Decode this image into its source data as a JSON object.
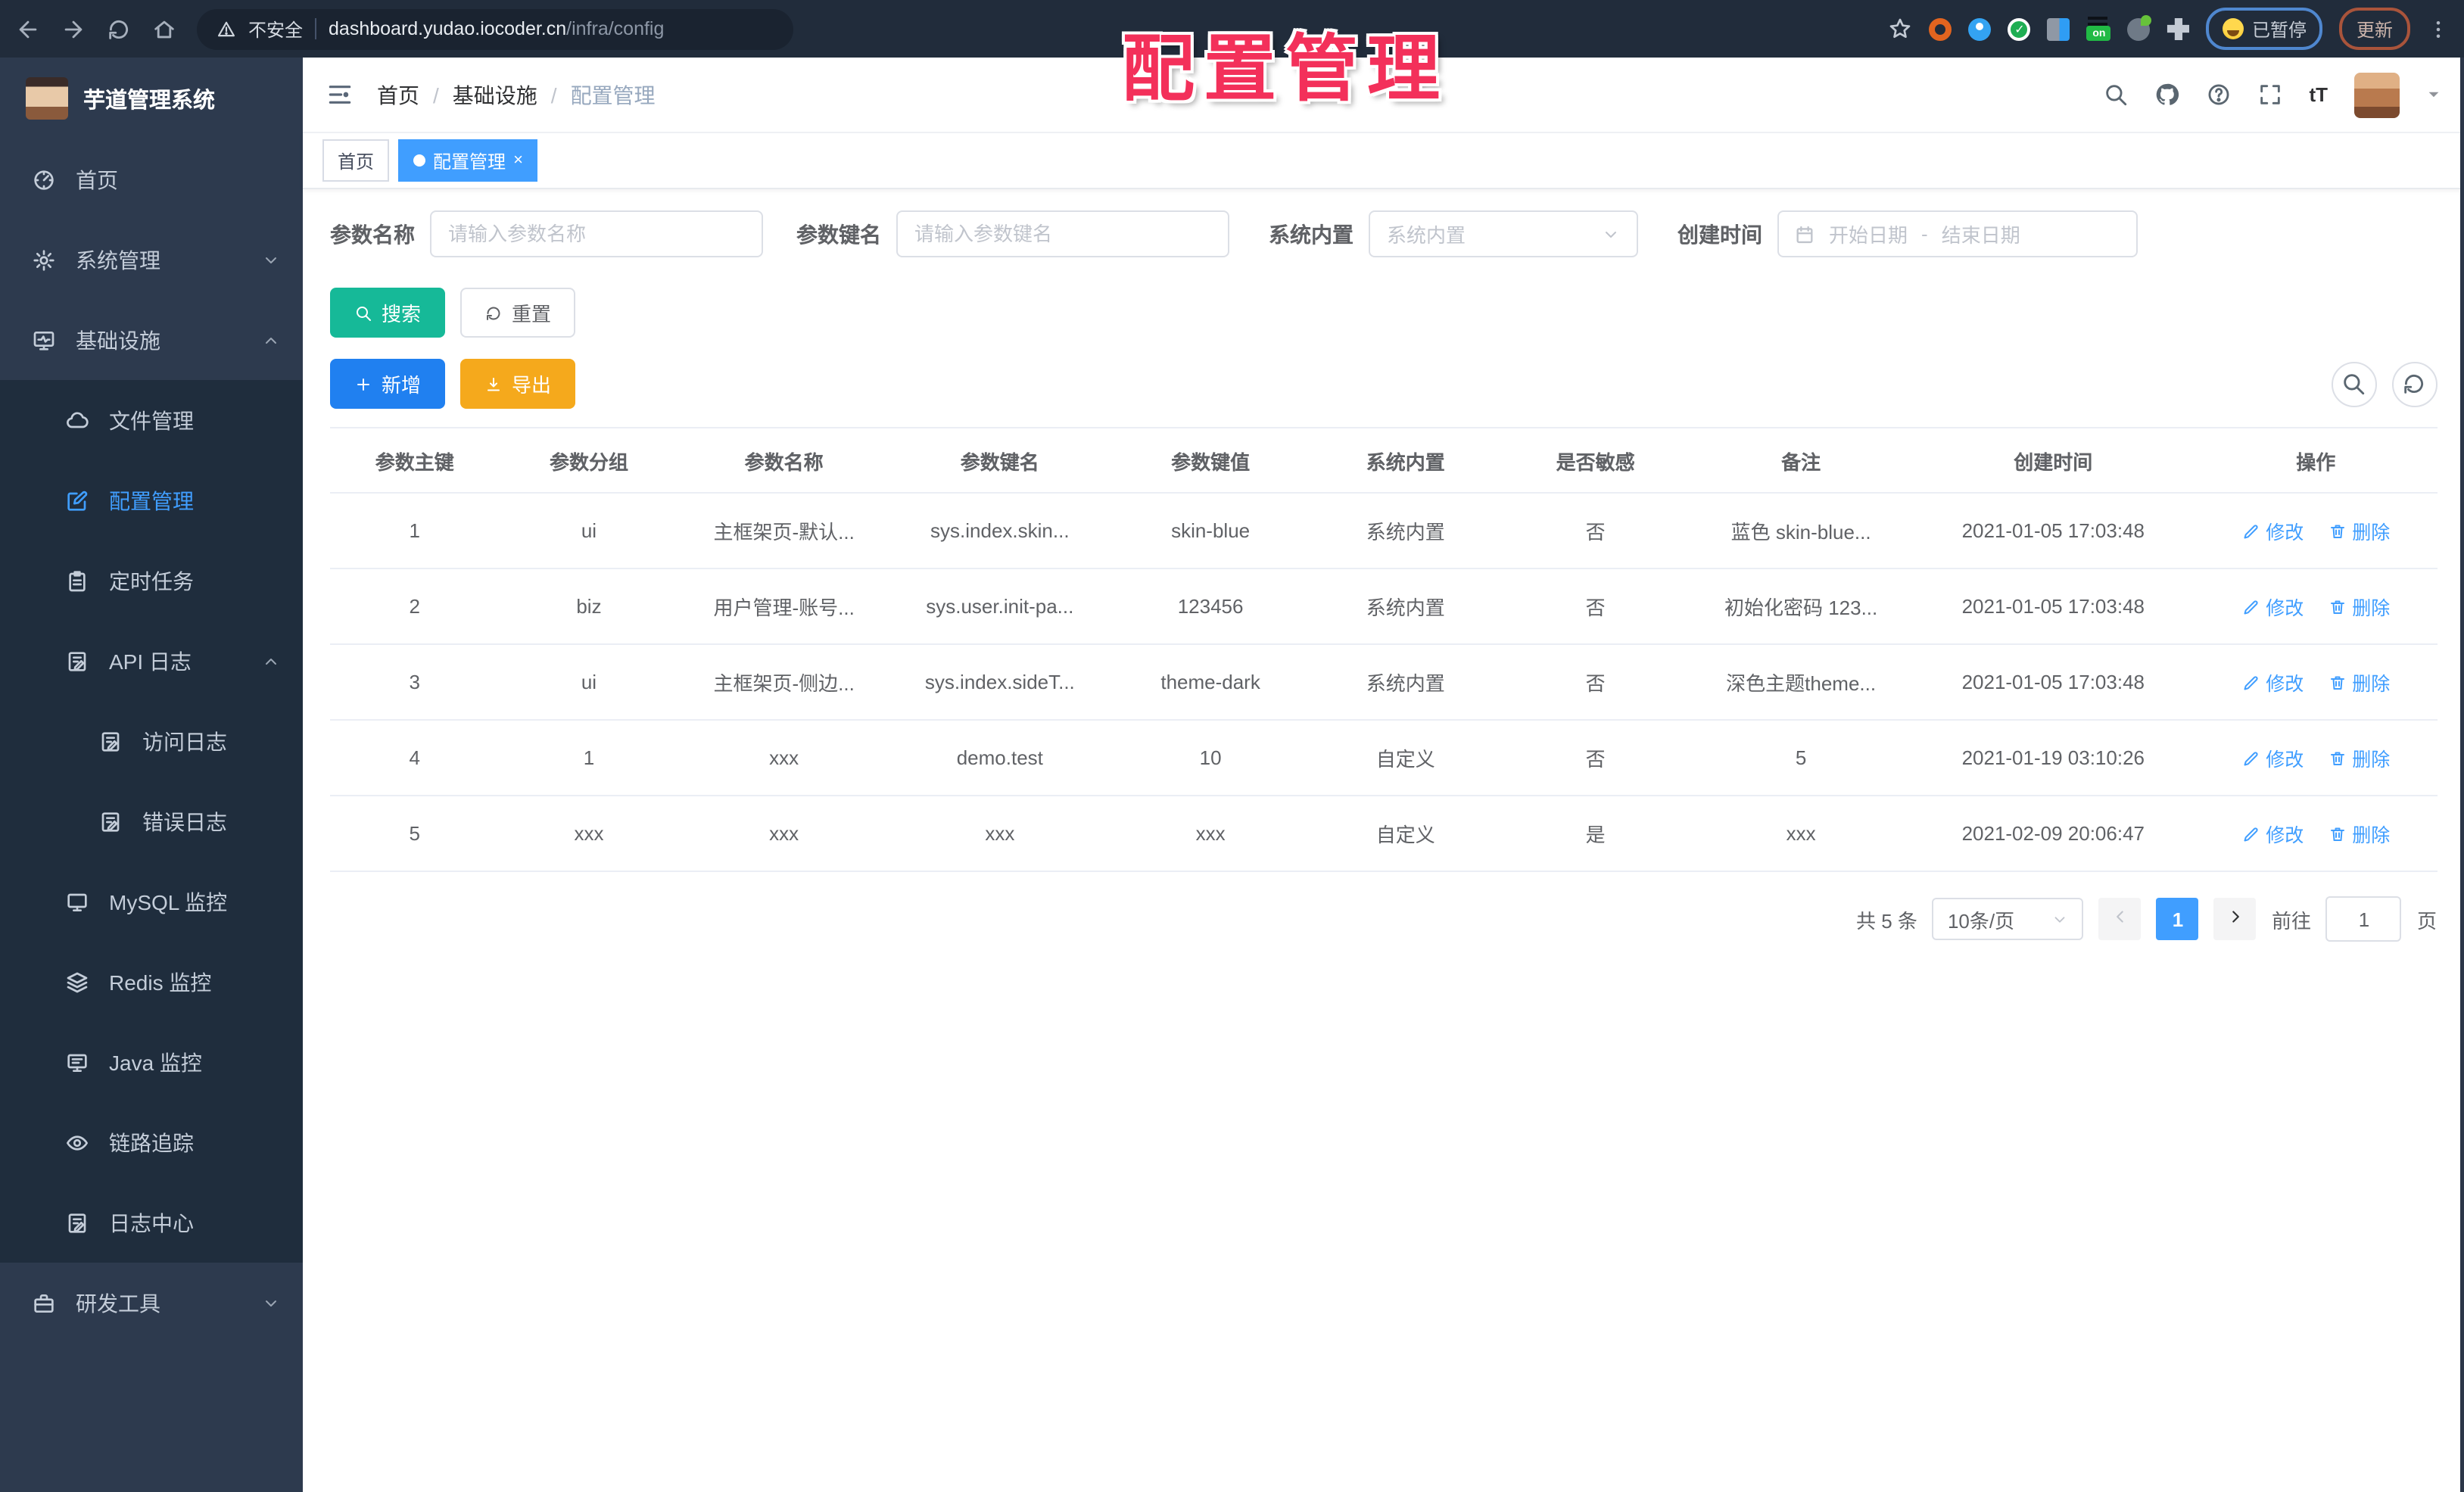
{
  "browser": {
    "security_label": "不安全",
    "host": "dashboard.yudao.iocoder.cn",
    "path": "/infra/config",
    "on_badge": "on",
    "paused_label": "已暂停",
    "update_label": "更新"
  },
  "overlay": {
    "text": "配置管理",
    "color": "#f3305a"
  },
  "sidebar": {
    "title": "芋道管理系统",
    "items": [
      {
        "label": "首页",
        "icon": "dashboard",
        "level": 1
      },
      {
        "label": "系统管理",
        "icon": "gear",
        "level": 1,
        "chevron": "down"
      },
      {
        "label": "基础设施",
        "icon": "infra",
        "level": 1,
        "chevron": "up"
      },
      {
        "label": "文件管理",
        "icon": "cloud",
        "level": 2
      },
      {
        "label": "配置管理",
        "icon": "edit",
        "level": 2,
        "active": true
      },
      {
        "label": "定时任务",
        "icon": "task",
        "level": 2
      },
      {
        "label": "API 日志",
        "icon": "log",
        "level": 2,
        "chevron": "up"
      },
      {
        "label": "访问日志",
        "icon": "log",
        "level": 3
      },
      {
        "label": "错误日志",
        "icon": "log",
        "level": 3
      },
      {
        "label": "MySQL 监控",
        "icon": "monitor",
        "level": 2
      },
      {
        "label": "Redis 监控",
        "icon": "layers",
        "level": 2
      },
      {
        "label": "Java 监控",
        "icon": "java",
        "level": 2
      },
      {
        "label": "链路追踪",
        "icon": "eye",
        "level": 2
      },
      {
        "label": "日志中心",
        "icon": "logcenter",
        "level": 2
      },
      {
        "label": "研发工具",
        "icon": "tool",
        "level": 1,
        "chevron": "down"
      }
    ]
  },
  "header": {
    "breadcrumb": [
      "首页",
      "基础设施",
      "配置管理"
    ],
    "font_icon": "tT"
  },
  "tags": [
    {
      "label": "首页",
      "active": false,
      "closable": false
    },
    {
      "label": "配置管理",
      "active": true,
      "closable": true
    }
  ],
  "filters": {
    "name_label": "参数名称",
    "name_placeholder": "请输入参数名称",
    "key_label": "参数键名",
    "key_placeholder": "请输入参数键名",
    "type_label": "系统内置",
    "type_placeholder": "系统内置",
    "date_label": "创建时间",
    "date_start": "开始日期",
    "date_separator": "-",
    "date_end": "结束日期",
    "search_label": "搜索",
    "reset_label": "重置"
  },
  "toolbar": {
    "add_label": "新增",
    "export_label": "导出"
  },
  "table": {
    "columns": [
      "参数主键",
      "参数分组",
      "参数名称",
      "参数键名",
      "参数键值",
      "系统内置",
      "是否敏感",
      "备注",
      "创建时间",
      "操作"
    ],
    "rows": [
      [
        "1",
        "ui",
        "主框架页-默认...",
        "sys.index.skin...",
        "skin-blue",
        "系统内置",
        "否",
        "蓝色 skin-blue...",
        "2021-01-05 17:03:48"
      ],
      [
        "2",
        "biz",
        "用户管理-账号...",
        "sys.user.init-pa...",
        "123456",
        "系统内置",
        "否",
        "初始化密码 123...",
        "2021-01-05 17:03:48"
      ],
      [
        "3",
        "ui",
        "主框架页-侧边...",
        "sys.index.sideT...",
        "theme-dark",
        "系统内置",
        "否",
        "深色主题theme...",
        "2021-01-05 17:03:48"
      ],
      [
        "4",
        "1",
        "xxx",
        "demo.test",
        "10",
        "自定义",
        "否",
        "5",
        "2021-01-19 03:10:26"
      ],
      [
        "5",
        "xxx",
        "xxx",
        "xxx",
        "xxx",
        "自定义",
        "是",
        "xxx",
        "2021-02-09 20:06:47"
      ]
    ],
    "edit_label": "修改",
    "delete_label": "删除"
  },
  "pagination": {
    "total_label": "共 5 条",
    "size_label": "10条/页",
    "current_page": "1",
    "goto_label": "前往",
    "goto_value": "1",
    "page_unit": "页"
  },
  "colors": {
    "accent": "#409eff",
    "sidebar_bg": "#2d3a4e",
    "submenu_bg": "#1f2d3d",
    "search_button": "#16b998",
    "add_button": "#2080f0",
    "export_button": "#f5a91c",
    "overlay_text": "#f3305a"
  }
}
